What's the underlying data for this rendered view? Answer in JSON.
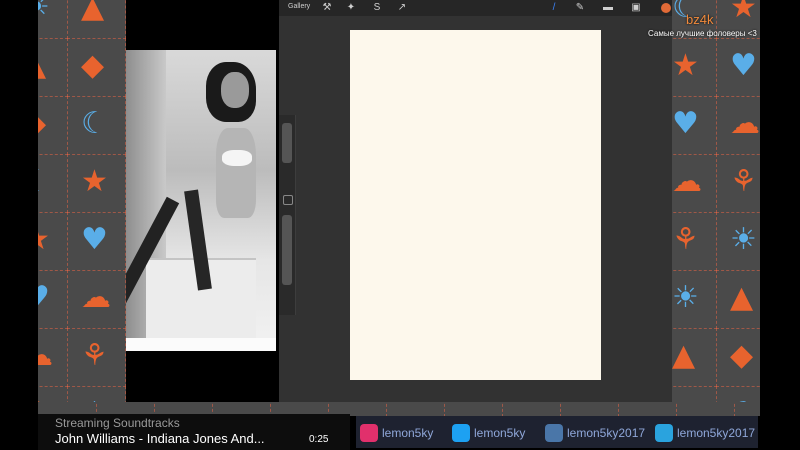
{
  "photo": {
    "description_icon": "photo-reference"
  },
  "app": {
    "gallery_label": "Gallery",
    "tools": [
      {
        "name": "wrench-icon",
        "glyph": "⚒",
        "active": false
      },
      {
        "name": "magic-wand-icon",
        "glyph": "✦",
        "active": false
      },
      {
        "name": "selection-icon",
        "glyph": "S",
        "active": false
      },
      {
        "name": "transform-icon",
        "glyph": "↗",
        "active": false
      },
      {
        "name": "brush-icon",
        "glyph": "/",
        "active": true
      },
      {
        "name": "smudge-icon",
        "glyph": "✎",
        "active": false
      },
      {
        "name": "eraser-icon",
        "glyph": "▬",
        "active": false
      },
      {
        "name": "layers-icon",
        "glyph": "▣",
        "active": false
      }
    ],
    "current_color": "#e06a37",
    "canvas_color": "#fdf8ec"
  },
  "overlay": {
    "title": "bz4k",
    "subtitle": "Самые лучшие фоловеры <3"
  },
  "music": {
    "label": "Streaming Soundtracks",
    "track": "John Williams - Indiana Jones And...",
    "time": "0:25"
  },
  "socials": [
    {
      "icon": "instagram-icon",
      "handle": "lemon5ky",
      "color": "#e1306c"
    },
    {
      "icon": "twitter-icon",
      "handle": "lemon5ky",
      "color": "#1da1f2"
    },
    {
      "icon": "vk-icon",
      "handle": "lemon5ky2017",
      "color": "#4a76a8"
    },
    {
      "icon": "telegram-icon",
      "handle": "lemon5ky2017",
      "color": "#2aa3de"
    }
  ],
  "theme": {
    "accent": "#f08a3c",
    "pattern_bg": "#4a4a4a",
    "icon_orange": "#e8632e",
    "icon_blue": "#5aaee8"
  }
}
